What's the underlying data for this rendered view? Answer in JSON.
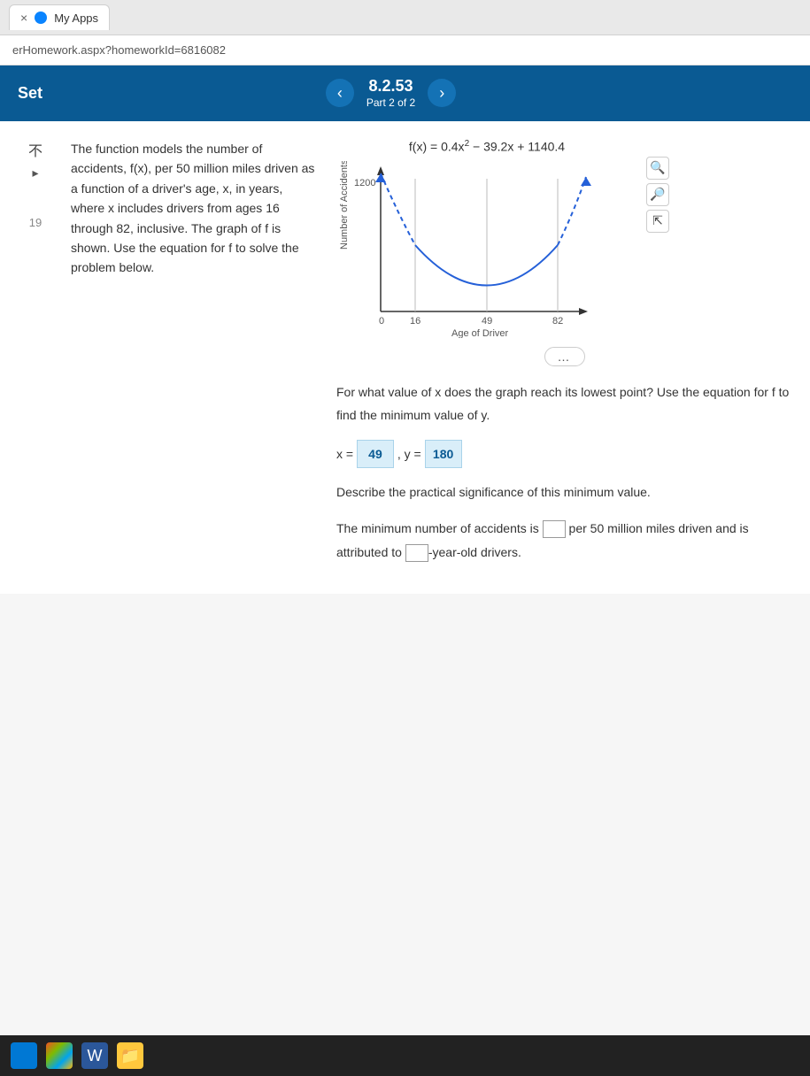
{
  "browser": {
    "tab_title": "My Apps",
    "tab_close": "×",
    "url": "erHomework.aspx?homeworkId=6816082"
  },
  "header": {
    "set_label": "Set",
    "question_number": "8.2.53",
    "part_label": "Part 2 of 2"
  },
  "problem": {
    "text": "The function models the number of accidents, f(x), per 50 million miles driven as a function of a driver's age, x, in years, where x includes drivers from ages 16 through 82, inclusive. The graph of f is shown. Use the equation for f to solve the problem below."
  },
  "chart_data": {
    "type": "line",
    "equation": "f(x) = 0.4x² − 39.2x + 1140.4",
    "xlabel": "Age of Driver",
    "ylabel": "Number of Accidents",
    "x_ticks": [
      0,
      16,
      49,
      82
    ],
    "y_ticks": [
      1200
    ],
    "xlim": [
      0,
      90
    ],
    "ylim": [
      0,
      1300
    ],
    "series": [
      {
        "name": "f(x)",
        "x": [
          16,
          30,
          49,
          70,
          82
        ],
        "values": [
          615.6,
          324.4,
          180.0,
          356.4,
          615.6
        ]
      }
    ],
    "vertex": {
      "x": 49,
      "y": 180
    }
  },
  "questions": {
    "q1": "For what value of x does the graph reach its lowest point? Use the equation for f to find the minimum value of y.",
    "x_label": "x =",
    "x_value": "49",
    "y_label": ", y =",
    "y_value": "180",
    "q2": "Describe the practical significance of this minimum value.",
    "sentence_a": "The minimum number of accidents is",
    "sentence_b": "per 50 million miles driven and is attributed to",
    "sentence_c": "-year-old drivers."
  },
  "sidebar": {
    "collapse": "不",
    "row_number": "19"
  }
}
